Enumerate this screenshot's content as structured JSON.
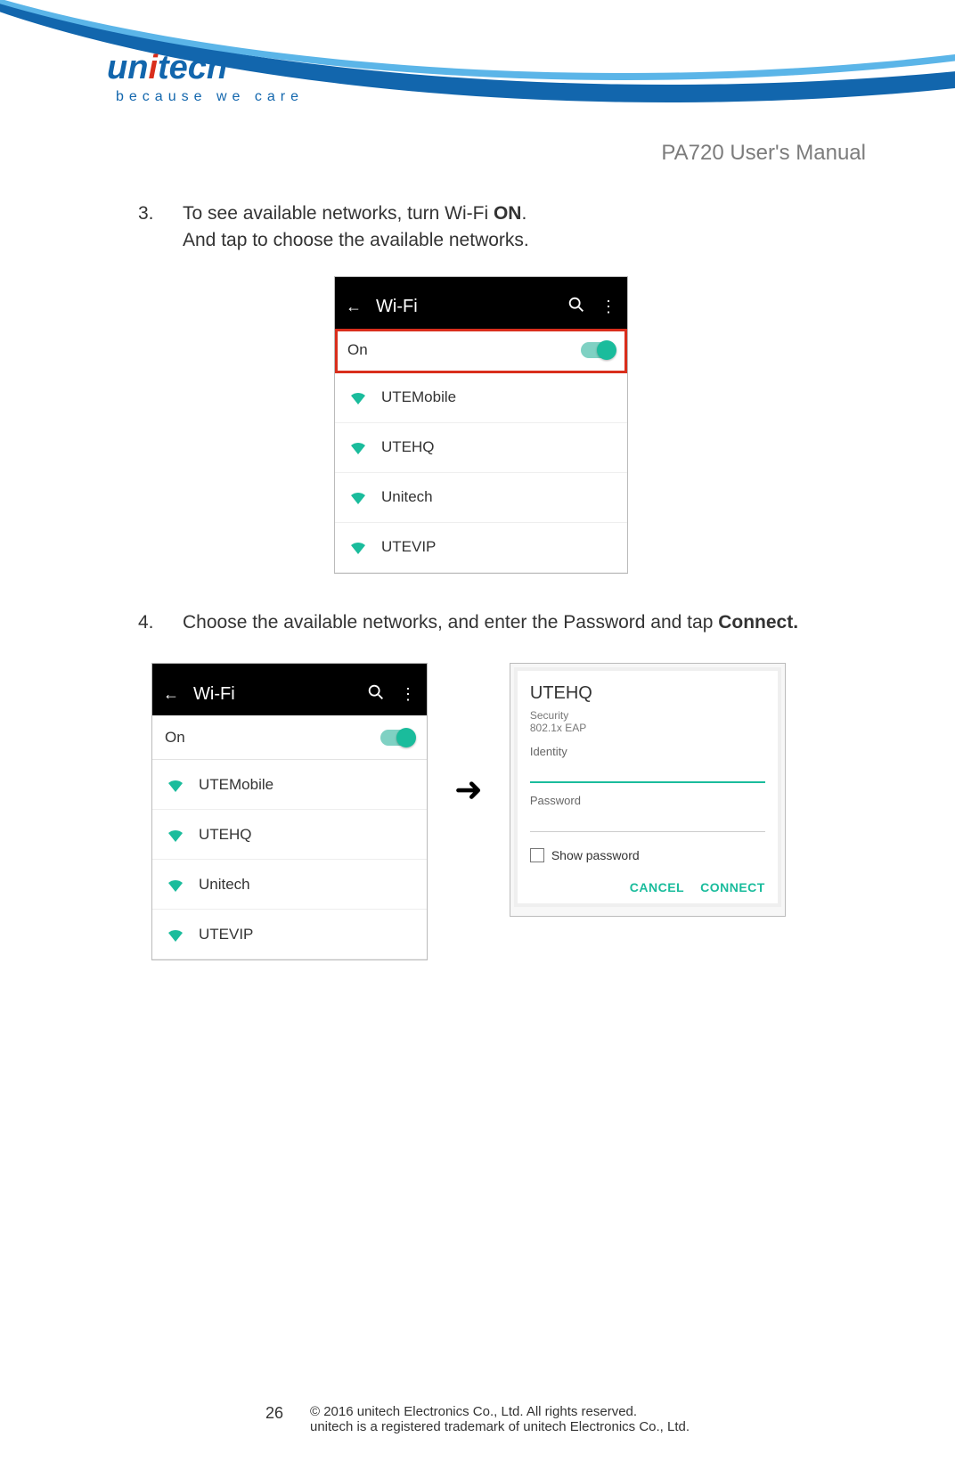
{
  "brand": {
    "name": "unitech",
    "tagline": "because we care",
    "doc_title": "PA720 User's Manual"
  },
  "steps": {
    "s3": {
      "num": "3.",
      "line1_a": "To see available networks, turn Wi-Fi ",
      "line1_b": "ON",
      "line1_c": ".",
      "line2": "And tap to choose the available networks."
    },
    "s4": {
      "num": "4.",
      "text_a": "Choose the available networks, and enter the Password and tap ",
      "text_b": "Connect.",
      "text_c": ""
    }
  },
  "wifi": {
    "appbar_title": "Wi-Fi",
    "toggle_label": "On",
    "networks": [
      "UTEMobile",
      "UTEHQ",
      "Unitech",
      "UTEVIP"
    ]
  },
  "dialog": {
    "ssid": "UTEHQ",
    "security_label": "Security",
    "security_value": "802.1x EAP",
    "identity_label": "Identity",
    "password_label": "Password",
    "show_password": "Show password",
    "cancel": "CANCEL",
    "connect": "CONNECT"
  },
  "footer": {
    "page": "26",
    "copyright": "© 2016 unitech Electronics Co., Ltd. All rights reserved.",
    "trademark": "unitech is a registered trademark of unitech Electronics Co., Ltd."
  }
}
